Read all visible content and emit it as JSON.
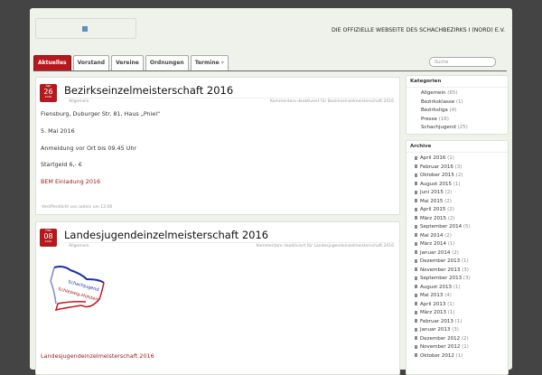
{
  "header": {
    "tagline": "DIE OFFIZIELLE WEBSEITE DES SCHACHBEZIRKS I (NORD) E.V.",
    "search_placeholder": "Suche"
  },
  "nav": [
    {
      "label": "Aktuelles"
    },
    {
      "label": "Vorstand"
    },
    {
      "label": "Vereine"
    },
    {
      "label": "Ordnungen"
    },
    {
      "label": "Termine ▿"
    }
  ],
  "posts": [
    {
      "month": "Apr",
      "day": "26",
      "year": "2016",
      "title": "Bezirkseinzelmeisterschaft 2016",
      "category": "Allgemein",
      "comments": "Kommentare deaktiviert für Bezirkseinzelmeisterschaft 2016",
      "lines": [
        "Flensburg, Duburger Str. 81, Haus „Pniel“",
        "5. Mai 2016",
        "Anmeldung vor Ort bis 09.45 Uhr",
        "Startgeld 6,- €"
      ],
      "link": "BEM Einladung 2016",
      "footer": "Veröffentlicht von admin um 12:00"
    },
    {
      "month": "Feb",
      "day": "08",
      "year": "2016",
      "title": "Landesjugendeinzelmeisterschaft 2016",
      "category": "Allgemein",
      "comments": "Kommentare deaktiviert für Landesjugendeinzelmeisterschaft 2016",
      "logo_text": "Schachjugend Schleswig-Holstein",
      "link": "Landesjugendeinzelmeisterschaft 2016"
    }
  ],
  "sidebar": {
    "categories_title": "Kategorien",
    "categories": [
      {
        "name": "Allgemein",
        "count": "(65)"
      },
      {
        "name": "Bezirksklasse",
        "count": "(1)"
      },
      {
        "name": "Bezirksliga",
        "count": "(4)"
      },
      {
        "name": "Presse",
        "count": "(16)"
      },
      {
        "name": "Schachjugend",
        "count": "(25)"
      }
    ],
    "archive_title": "Archive",
    "archive": [
      {
        "name": "April 2016",
        "count": "(1)"
      },
      {
        "name": "Februar 2016",
        "count": "(3)"
      },
      {
        "name": "Oktober 2015",
        "count": "(2)"
      },
      {
        "name": "August 2015",
        "count": "(1)"
      },
      {
        "name": "Juni 2015",
        "count": "(2)"
      },
      {
        "name": "Mai 2015",
        "count": "(2)"
      },
      {
        "name": "April 2015",
        "count": "(2)"
      },
      {
        "name": "März 2015",
        "count": "(2)"
      },
      {
        "name": "September 2014",
        "count": "(5)"
      },
      {
        "name": "Mai 2014",
        "count": "(2)"
      },
      {
        "name": "März 2014",
        "count": "(1)"
      },
      {
        "name": "Januar 2014",
        "count": "(2)"
      },
      {
        "name": "Dezember 2013",
        "count": "(1)"
      },
      {
        "name": "November 2013",
        "count": "(3)"
      },
      {
        "name": "September 2013",
        "count": "(3)"
      },
      {
        "name": "August 2013",
        "count": "(1)"
      },
      {
        "name": "Mai 2013",
        "count": "(4)"
      },
      {
        "name": "April 2013",
        "count": "(1)"
      },
      {
        "name": "März 2013",
        "count": "(1)"
      },
      {
        "name": "Februar 2013",
        "count": "(1)"
      },
      {
        "name": "Januar 2013",
        "count": "(3)"
      },
      {
        "name": "Dezember 2012",
        "count": "(2)"
      },
      {
        "name": "November 2012",
        "count": "(1)"
      },
      {
        "name": "Oktober 2012",
        "count": "(1)"
      }
    ]
  }
}
